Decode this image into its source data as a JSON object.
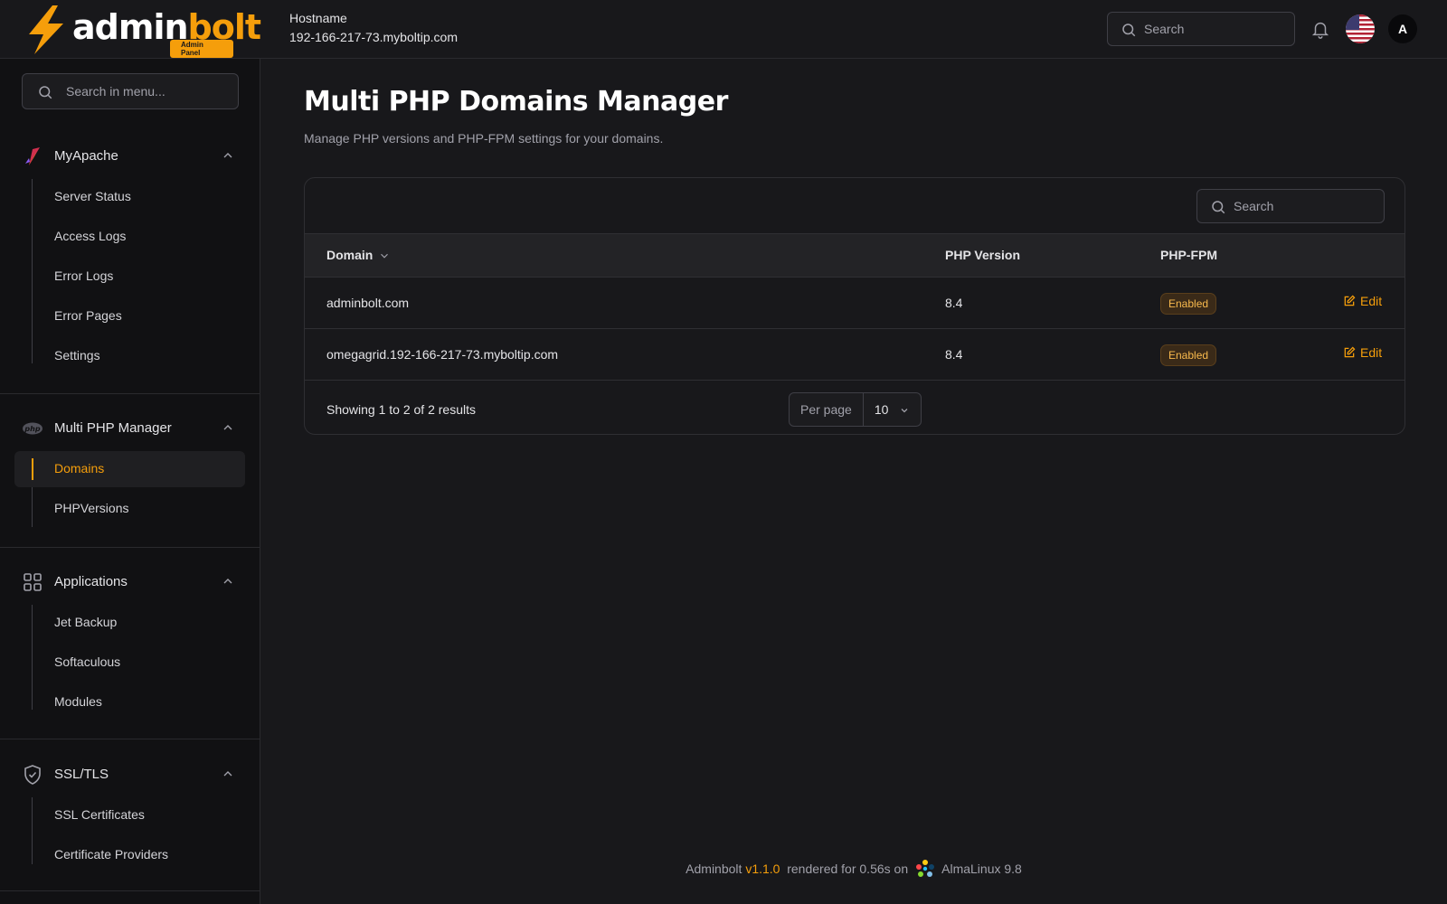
{
  "header": {
    "logo_text_main": "admin",
    "logo_text_accent": "bolt",
    "logo_badge": "Admin Panel",
    "hostname_label": "Hostname",
    "hostname_value": "192-166-217-73.myboltip.com",
    "search_placeholder": "Search",
    "avatar_initial": "A",
    "icons": [
      "search-icon",
      "bell-icon",
      "us-flag-icon"
    ]
  },
  "sidebar": {
    "search_placeholder": "Search in menu...",
    "groups": [
      {
        "title": "MyApache",
        "icon": "apache-feather-icon",
        "items": [
          {
            "label": "Server Status"
          },
          {
            "label": "Access Logs"
          },
          {
            "label": "Error Logs"
          },
          {
            "label": "Error Pages"
          },
          {
            "label": "Settings"
          }
        ]
      },
      {
        "title": "Multi PHP Manager",
        "icon": "php-icon",
        "items": [
          {
            "label": "Domains",
            "active": true
          },
          {
            "label": "PHPVersions"
          }
        ]
      },
      {
        "title": "Applications",
        "icon": "grid-icon",
        "items": [
          {
            "label": "Jet Backup"
          },
          {
            "label": "Softaculous"
          },
          {
            "label": "Modules"
          }
        ]
      },
      {
        "title": "SSL/TLS",
        "icon": "shield-check-icon",
        "items": [
          {
            "label": "SSL Certificates"
          },
          {
            "label": "Certificate Providers"
          }
        ]
      }
    ]
  },
  "main": {
    "title": "Multi PHP Domains Manager",
    "subtitle": "Manage PHP versions and PHP-FPM settings for your domains.",
    "table": {
      "search_placeholder": "Search",
      "columns": [
        "Domain",
        "PHP Version",
        "PHP-FPM"
      ],
      "rows": [
        {
          "domain": "adminbolt.com",
          "php_version": "8.4",
          "php_fpm": "Enabled",
          "action": "Edit"
        },
        {
          "domain": "omegagrid.192-166-217-73.myboltip.com",
          "php_version": "8.4",
          "php_fpm": "Enabled",
          "action": "Edit"
        }
      ],
      "showing_text": "Showing 1 to 2 of 2 results",
      "per_page_label": "Per page",
      "per_page_value": "10"
    }
  },
  "footer": {
    "app_name": "Adminbolt",
    "version": "v1.1.0",
    "rendered_text": "rendered for 0.56s on",
    "os": "AlmaLinux 9.8"
  },
  "colors": {
    "accent": "#f59e0b",
    "background": "#18181b",
    "sidebar": "#111113"
  }
}
